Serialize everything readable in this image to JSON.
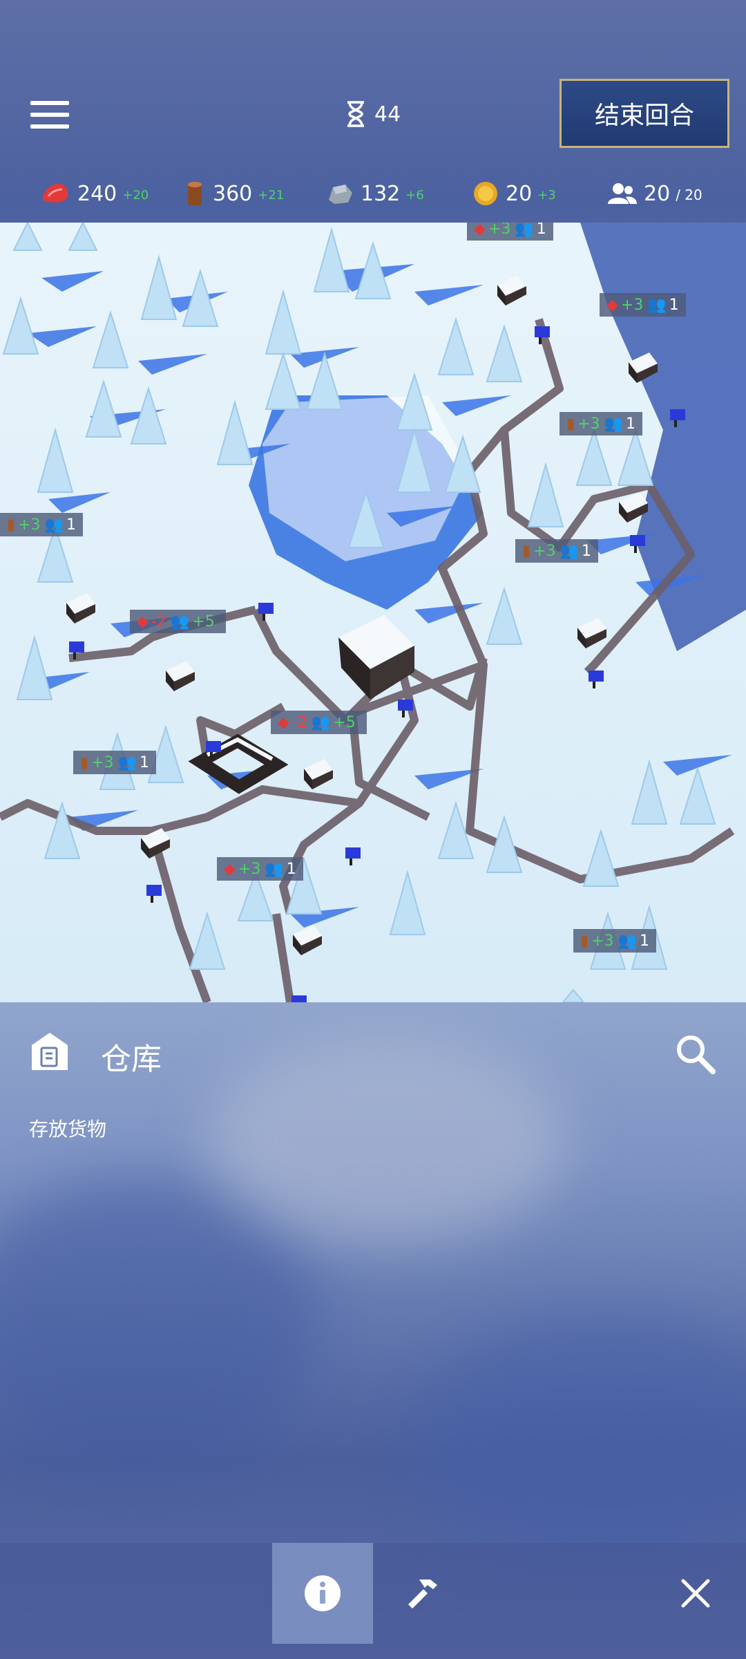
{
  "top": {
    "turn_count": "44",
    "end_turn_label": "结束回合"
  },
  "resources": [
    {
      "icon": "meat-icon",
      "value": "240",
      "delta": "+20"
    },
    {
      "icon": "wood-icon",
      "value": "360",
      "delta": "+21"
    },
    {
      "icon": "stone-icon",
      "value": "132",
      "delta": "+6"
    },
    {
      "icon": "gold-icon",
      "value": "20",
      "delta": "+3"
    },
    {
      "icon": "population-icon",
      "value": "20",
      "cap": "/ 20"
    }
  ],
  "map_labels": [
    {
      "res": "meat",
      "delta": "+3",
      "workers": "1"
    },
    {
      "res": "meat",
      "delta": "+3",
      "workers": "1"
    },
    {
      "res": "wood",
      "delta": "+3",
      "workers": "1"
    },
    {
      "res": "wood",
      "delta": "+3",
      "workers": "1"
    },
    {
      "res": "wood",
      "delta": "+3",
      "workers": "1"
    },
    {
      "res": "meat",
      "delta": "-2",
      "workers": "+5"
    },
    {
      "res": "meat",
      "delta": "-2",
      "workers": "+5"
    },
    {
      "res": "wood",
      "delta": "+3",
      "workers": "1"
    },
    {
      "res": "meat",
      "delta": "+3",
      "workers": "1"
    },
    {
      "res": "wood",
      "delta": "+3",
      "workers": "1"
    }
  ],
  "panel": {
    "building_name": "仓库",
    "building_desc": "存放货物"
  },
  "colors": {
    "accent_gold": "#c9b47a",
    "positive": "#4fd26a",
    "negative": "#ff3b3b",
    "territory": "#2f6fe0"
  }
}
